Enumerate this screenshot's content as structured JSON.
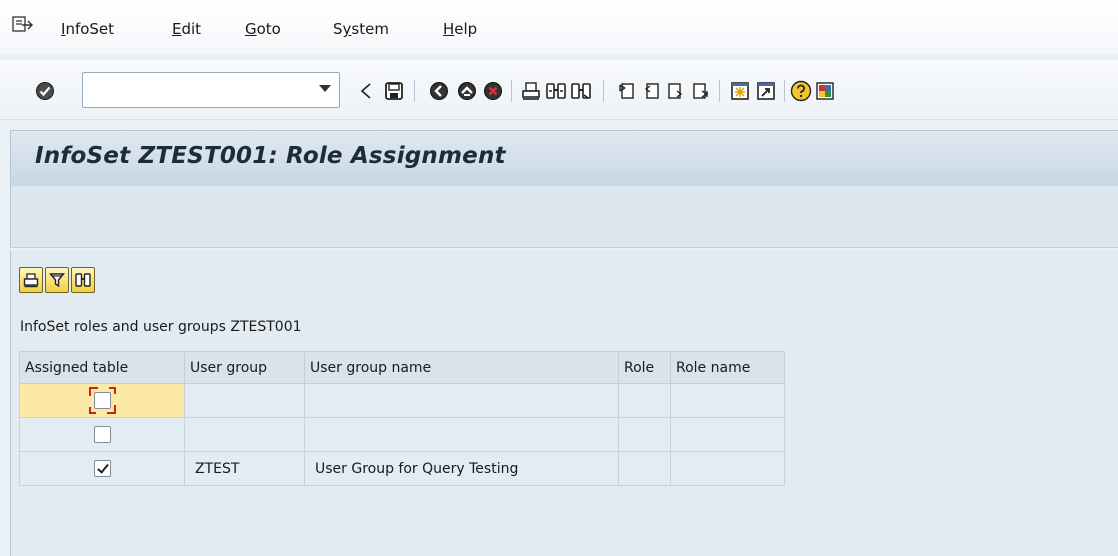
{
  "menu": {
    "items": [
      {
        "label": "InfoSet",
        "underline": "I"
      },
      {
        "label": "Edit",
        "underline": "E"
      },
      {
        "label": "Goto",
        "underline": "G"
      },
      {
        "label": "System",
        "underline": "y"
      },
      {
        "label": "Help",
        "underline": "H"
      }
    ]
  },
  "toolbar": {
    "command_field_value": "",
    "icons": [
      "enter-icon",
      "back-arrow-icon",
      "save-icon",
      "back-icon",
      "exit-icon",
      "cancel-icon",
      "print-icon",
      "find-icon",
      "find-next-icon",
      "first-page-icon",
      "previous-page-icon",
      "next-page-icon",
      "last-page-icon",
      "create-session-icon",
      "create-shortcut-icon",
      "help-icon",
      "customize-layout-icon"
    ]
  },
  "title": "InfoSet ZTEST001: Role Assignment",
  "grid": {
    "caption": "InfoSet roles and user groups ZTEST001",
    "toolbar_icons": [
      "print-icon",
      "filter-icon",
      "find-icon"
    ],
    "columns": [
      "Assigned table",
      "User group",
      "User group name",
      "Role",
      "Role name"
    ],
    "rows": [
      {
        "assigned": false,
        "user_group": "",
        "user_group_name": "",
        "role": "",
        "role_name": "",
        "selected": true
      },
      {
        "assigned": false,
        "user_group": "",
        "user_group_name": "",
        "role": "",
        "role_name": "",
        "selected": false
      },
      {
        "assigned": true,
        "user_group": "ZTEST",
        "user_group_name": "User Group for Query Testing",
        "role": "",
        "role_name": "",
        "selected": false
      }
    ]
  }
}
